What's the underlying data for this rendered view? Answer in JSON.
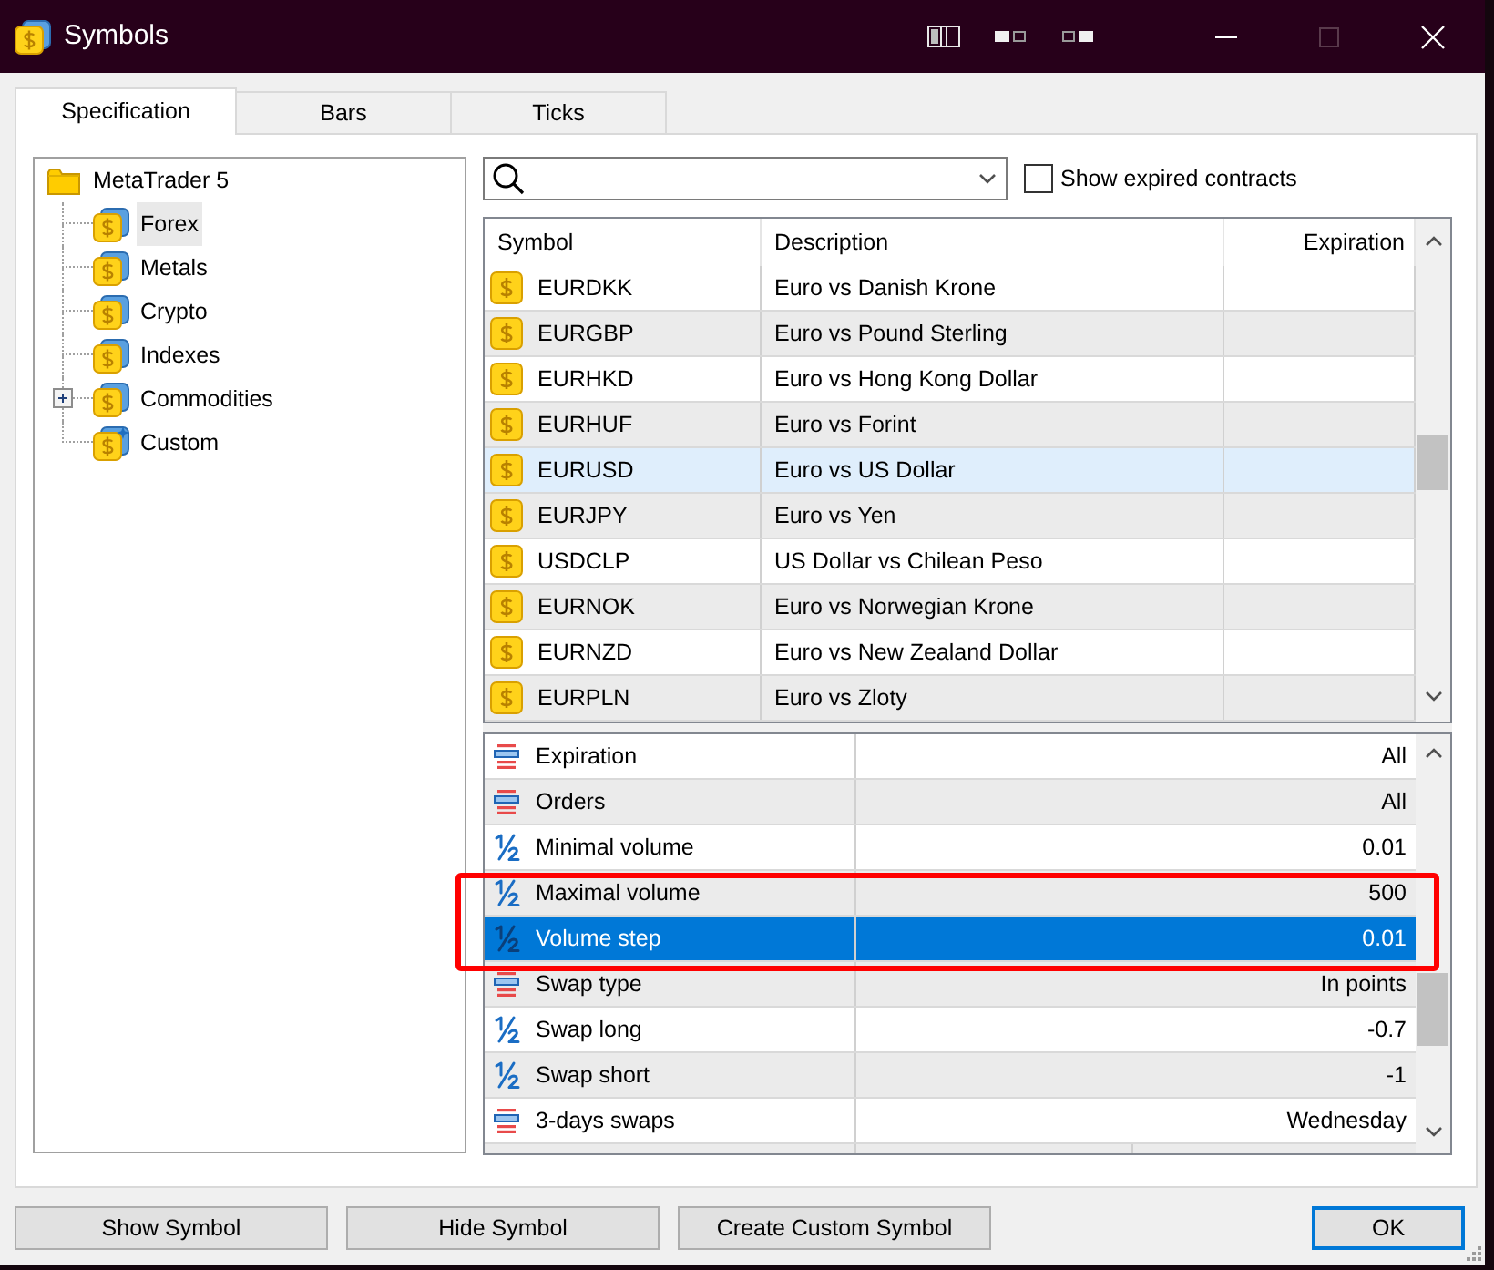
{
  "window": {
    "title": "Symbols",
    "maximize_disabled": true
  },
  "tabs": [
    {
      "label": "Specification",
      "selected": true
    },
    {
      "label": "Bars",
      "selected": false
    },
    {
      "label": "Ticks",
      "selected": false
    }
  ],
  "tree": {
    "label": "MetaTrader 5",
    "children": [
      {
        "label": "Forex",
        "kind": "group",
        "selected": true,
        "collapsed": false
      },
      {
        "label": "Metals",
        "kind": "group",
        "selected": false,
        "collapsed": false
      },
      {
        "label": "Crypto",
        "kind": "group",
        "selected": false,
        "collapsed": false
      },
      {
        "label": "Indexes",
        "kind": "group",
        "selected": false,
        "collapsed": false
      },
      {
        "label": "Commodities",
        "kind": "group",
        "selected": false,
        "collapsed": true
      },
      {
        "label": "Custom",
        "kind": "custom",
        "selected": false,
        "collapsed": false
      }
    ]
  },
  "filter": {
    "show_expired": {
      "label": "Show expired contracts",
      "checked": false
    }
  },
  "symbols_table": {
    "columns": [
      "Symbol",
      "Description",
      "Expiration"
    ],
    "rows": [
      {
        "symbol": "EURDKK",
        "description": "Euro vs Danish Krone",
        "selected": false
      },
      {
        "symbol": "EURGBP",
        "description": "Euro vs Pound Sterling",
        "selected": false
      },
      {
        "symbol": "EURHKD",
        "description": "Euro vs Hong Kong Dollar",
        "selected": false
      },
      {
        "symbol": "EURHUF",
        "description": "Euro vs Forint",
        "selected": false
      },
      {
        "symbol": "EURUSD",
        "description": "Euro vs US Dollar",
        "selected": true
      },
      {
        "symbol": "EURJPY",
        "description": "Euro vs Yen",
        "selected": false
      },
      {
        "symbol": "USDCLP",
        "description": "US Dollar vs Chilean Peso",
        "selected": false
      },
      {
        "symbol": "EURNOK",
        "description": "Euro vs Norwegian Krone",
        "selected": false
      },
      {
        "symbol": "EURNZD",
        "description": "Euro vs New Zealand Dollar",
        "selected": false
      },
      {
        "symbol": "EURPLN",
        "description": "Euro vs Zloty",
        "selected": false
      }
    ]
  },
  "properties": {
    "rows": [
      {
        "kind": "enum",
        "name": "Expiration",
        "value": "All",
        "selected": false,
        "marked": false
      },
      {
        "kind": "enum",
        "name": "Orders",
        "value": "All",
        "selected": false,
        "marked": false
      },
      {
        "kind": "numeric",
        "name": "Minimal volume",
        "value": "0.01",
        "selected": false,
        "marked": false
      },
      {
        "kind": "numeric",
        "name": "Maximal volume",
        "value": "500",
        "selected": false,
        "marked": true
      },
      {
        "kind": "numeric",
        "name": "Volume step",
        "value": "0.01",
        "selected": true,
        "marked": true
      },
      {
        "kind": "enum",
        "name": "Swap type",
        "value": "In points",
        "selected": false,
        "marked": false
      },
      {
        "kind": "numeric",
        "name": "Swap long",
        "value": "-0.7",
        "selected": false,
        "marked": false
      },
      {
        "kind": "numeric",
        "name": "Swap short",
        "value": "-1",
        "selected": false,
        "marked": false
      },
      {
        "kind": "enum",
        "name": "3-days swaps",
        "value": "Wednesday",
        "selected": false,
        "marked": false
      }
    ]
  },
  "buttons": [
    {
      "label": "Show Symbol",
      "default": false
    },
    {
      "label": "Hide Symbol",
      "default": false
    },
    {
      "label": "Create Custom Symbol",
      "default": false
    },
    {
      "label": "OK",
      "default": true
    }
  ]
}
